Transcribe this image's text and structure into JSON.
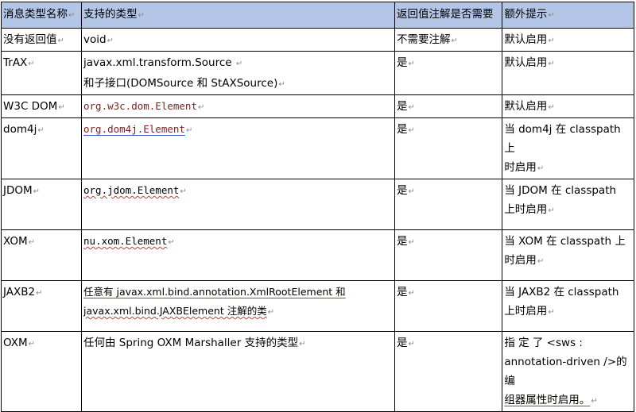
{
  "headers": [
    "消息类型名称",
    "支持的类型",
    "返回值注解是否需要",
    "额外提示"
  ],
  "mark": "↵",
  "rows": [
    {
      "name": "没有返回值",
      "type_line1": "void",
      "type_line2": "",
      "required": "不需要注解",
      "hint": "默认启用"
    },
    {
      "name": "TrAX",
      "type_line1": "javax.xml.transform.Source",
      "type_line2": "和子接口(DOMSource 和 StAXSource)",
      "required": "是",
      "hint": "默认启用"
    },
    {
      "name": "W3C DOM",
      "type_line1": "org.w3c.dom.Element",
      "type_line2": "",
      "required": "是",
      "hint": "默认启用"
    },
    {
      "name": "dom4j",
      "type_line1": "org.dom4j.Element",
      "type_line2": "",
      "required": "是",
      "hint_line1": "当 dom4j 在 classpath 上",
      "hint_line2": "时启用"
    },
    {
      "name": "JDOM",
      "type_line1": "org.jdom.Element",
      "type_line2": "",
      "required": "是",
      "hint_line1": "当  JDOM  在  classpath",
      "hint_line2": "上时启用"
    },
    {
      "name": "XOM",
      "type_line1": "nu.xom.Element",
      "type_line2": "",
      "required": "是",
      "hint_line1": "当 XOM 在 classpath 上",
      "hint_line2": "时启用"
    },
    {
      "name": "JAXB2",
      "type_line1": "任意有 javax.xml.bind.annotation.XmlRootElement 和",
      "type_line2": "javax.xml.bind.JAXBElement 注解的类",
      "required": "是",
      "hint_line1": "当  JAXB2  在  classpath",
      "hint_line2": "上时启用"
    },
    {
      "name": "OXM",
      "type_line1": "任何由 Spring OXM Marshaller 支持的类型",
      "type_line2": "",
      "required": "是",
      "hint_line1": "指   定   了   <sws   :",
      "hint_line2": "annotation-driven />的编",
      "hint_line3": "组器属性时启用。"
    }
  ]
}
